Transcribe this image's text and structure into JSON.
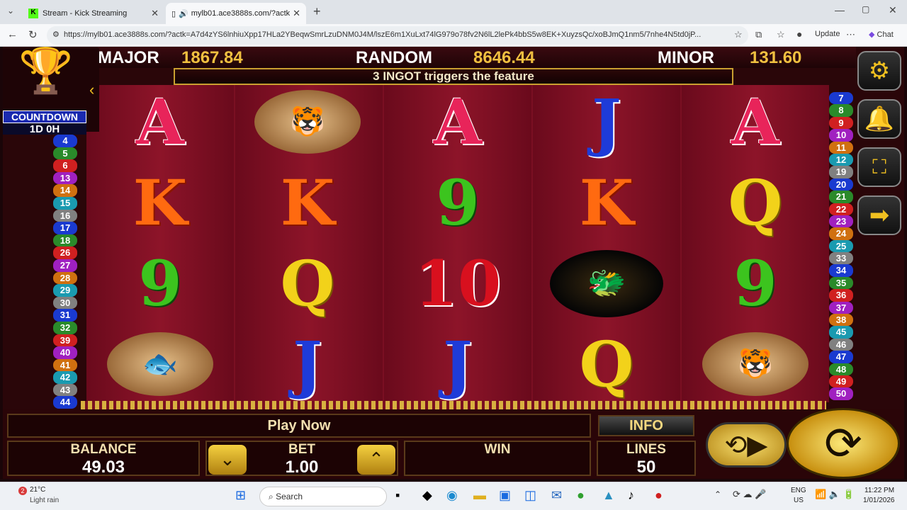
{
  "browser": {
    "tabs": [
      {
        "title": "Stream - Kick Streaming"
      },
      {
        "title": "mylb01.ace3888s.com/?actk"
      }
    ],
    "url": "https://mylb01.ace3888s.com/?actk=A7d4zYS6lnhiuXpp17HLa2YBeqwSmrLzuDNM0J4M/lszE6m1XuLxt74lG979o78fv2N6lL2lePk4bbS5w8EK+XuyzsQc/xoBJmQ1nm5/7nhe4N5td0jP...",
    "update_label": "Update",
    "chat_label": "Chat"
  },
  "jackpot": {
    "major_label": "MAJOR",
    "major_value": "1867.84",
    "random_label": "RANDOM",
    "random_value": "8646.44",
    "minor_label": "MINOR",
    "minor_value": "131.60"
  },
  "banner": "3 INGOT triggers the feature",
  "countdown": {
    "label": "COUNTDOWN",
    "value": "1D 0H"
  },
  "reels": [
    [
      "A",
      "K",
      "9",
      "fish"
    ],
    [
      "tiger",
      "K",
      "Q",
      "J"
    ],
    [
      "A",
      "9",
      "10",
      "J"
    ],
    [
      "J",
      "K",
      "dragon",
      "Q"
    ],
    [
      "A",
      "Q",
      "9",
      "tiger"
    ]
  ],
  "left_lines": [
    "4",
    "5",
    "6",
    "13",
    "14",
    "15",
    "16",
    "17",
    "18",
    "26",
    "27",
    "28",
    "29",
    "30",
    "31",
    "32",
    "39",
    "40",
    "41",
    "42",
    "43",
    "44"
  ],
  "right_lines": [
    "7",
    "8",
    "9",
    "10",
    "11",
    "12",
    "19",
    "20",
    "21",
    "22",
    "23",
    "24",
    "25",
    "33",
    "34",
    "35",
    "36",
    "37",
    "38",
    "45",
    "46",
    "47",
    "48",
    "49",
    "50"
  ],
  "bottom": {
    "play_now": "Play Now",
    "info": "INFO",
    "balance_label": "BALANCE",
    "balance_value": "49.03",
    "bet_label": "BET",
    "bet_value": "1.00",
    "win_label": "WIN",
    "win_value": "",
    "lines_label": "LINES",
    "lines_value": "50"
  },
  "taskbar": {
    "temp": "21°C",
    "weather": "Light rain",
    "search": "Search",
    "lang": "ENG",
    "region": "US",
    "time": "11:22 PM",
    "date": "1/01/2026"
  }
}
